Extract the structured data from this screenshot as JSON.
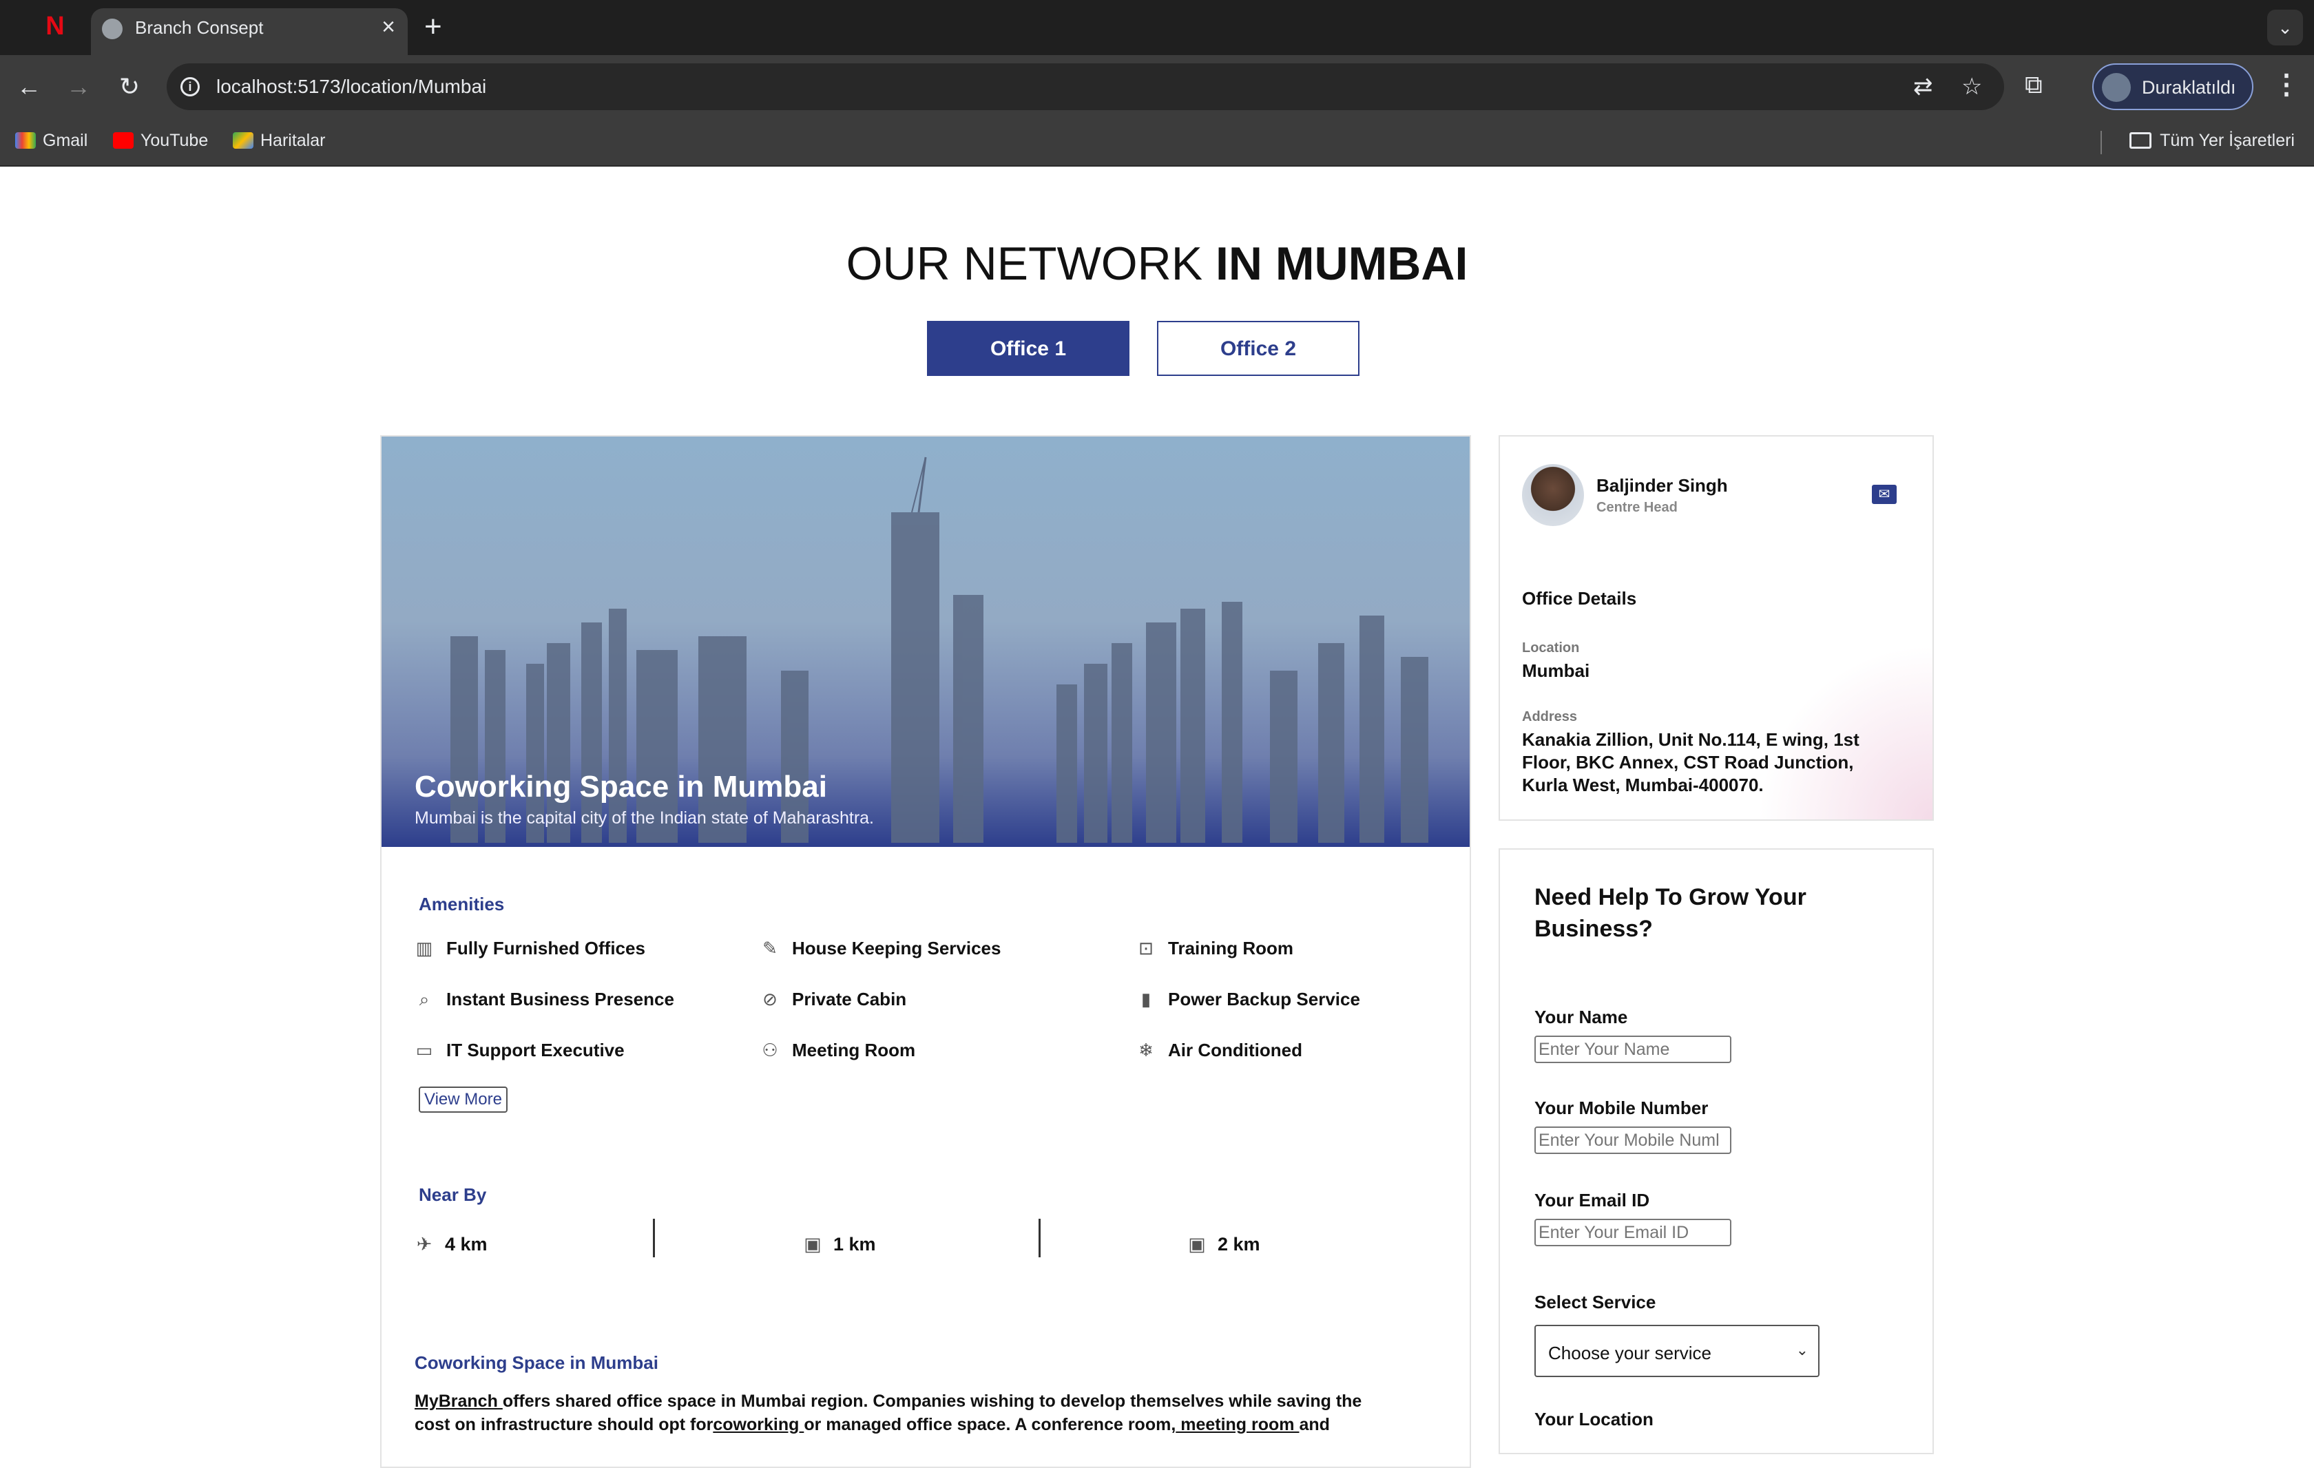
{
  "browser": {
    "tab_title": "Branch Consept",
    "tab_close": "×",
    "new_tab": "+",
    "tab_search": "⌄",
    "url": "localhost:5173/location/Mumbai",
    "profile_label": "Duraklatıldı",
    "bookmarks": [
      "Gmail",
      "YouTube",
      "Haritalar"
    ],
    "all_bookmarks": "Tüm Yer İşaretleri"
  },
  "page": {
    "heading_normal": "OUR NETWORK ",
    "heading_bold": "IN MUMBAI",
    "office_tabs": [
      "Office 1",
      "Office 2"
    ],
    "active_office": 0
  },
  "hero": {
    "title": "Coworking Space in Mumbai",
    "subtitle": "Mumbai is the capital city of the Indian state of Maharashtra."
  },
  "amenities": {
    "title": "Amenities",
    "items": [
      {
        "label": "Fully Furnished Offices",
        "icon": "building-icon"
      },
      {
        "label": "House Keeping Services",
        "icon": "broom-icon"
      },
      {
        "label": "Training Room",
        "icon": "training-icon"
      },
      {
        "label": "Instant Business Presence",
        "icon": "search-icon"
      },
      {
        "label": "Private Cabin",
        "icon": "eye-off-icon"
      },
      {
        "label": "Power Backup Service",
        "icon": "plug-icon"
      },
      {
        "label": "IT Support Executive",
        "icon": "monitor-icon"
      },
      {
        "label": "Meeting Room",
        "icon": "people-icon"
      },
      {
        "label": "Air Conditioned",
        "icon": "snowflake-icon"
      }
    ],
    "view_more": "View More"
  },
  "near_by": {
    "title": "Near By",
    "items": [
      {
        "distance": "4 km",
        "icon": "airplane-icon"
      },
      {
        "distance": "1 km",
        "icon": "train-icon"
      },
      {
        "distance": "2 km",
        "icon": "bus-icon"
      }
    ]
  },
  "about": {
    "title": "Coworking Space in Mumbai",
    "link_mybranch": "MyBranch ",
    "text_1": "offers shared office space in Mumbai region. Companies wishing to develop themselves while saving the cost on infrastructure should opt for",
    "link_coworking": "coworking ",
    "text_2": "or managed office space. A conference room,",
    "link_meeting": " meeting room ",
    "text_3": "and"
  },
  "contact": {
    "name": "Baljinder Singh",
    "role": "Centre Head",
    "office_details_title": "Office Details",
    "location_label": "Location",
    "location_value": "Mumbai",
    "address_label": "Address",
    "address_value": "Kanakia Zillion, Unit No.114, E wing, 1st Floor, BKC Annex, CST Road Junction, Kurla West, Mumbai-400070."
  },
  "form": {
    "title": "Need Help To Grow Your Business?",
    "name_label": "Your Name",
    "name_placeholder": "Enter Your Name",
    "mobile_label": "Your Mobile Number",
    "mobile_placeholder": "Enter Your Mobile Numl",
    "email_label": "Your Email ID",
    "email_placeholder": "Enter Your Email ID",
    "service_label": "Select Service",
    "service_value": "Choose your service",
    "location_label": "Your Location"
  },
  "colors": {
    "brand": "#2d3e8c",
    "chrome_dark": "#1f1f1f",
    "chrome": "#3c3c3c"
  }
}
